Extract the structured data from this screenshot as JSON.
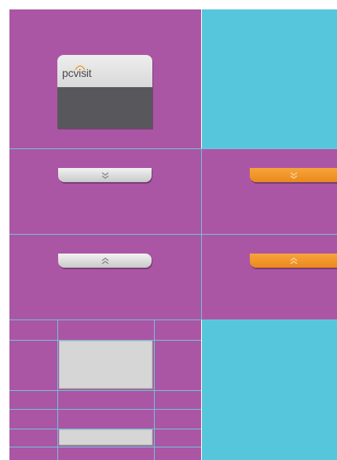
{
  "logo": {
    "text": "pcvisit",
    "arc_color": "#f0a030"
  },
  "colors": {
    "purple": "#ab56a4",
    "cyan": "#56c6dc",
    "grid_line": "#6ec4dc",
    "tab_grey": "#d0d0d0",
    "tab_orange": "#ef941e",
    "card_dark": "#58585c"
  },
  "buttons": {
    "collapse_grey_icon": "chevron-double-down-icon",
    "collapse_orange_icon": "chevron-double-down-icon",
    "expand_grey_icon": "chevron-double-up-icon",
    "expand_orange_icon": "chevron-double-up-icon"
  }
}
